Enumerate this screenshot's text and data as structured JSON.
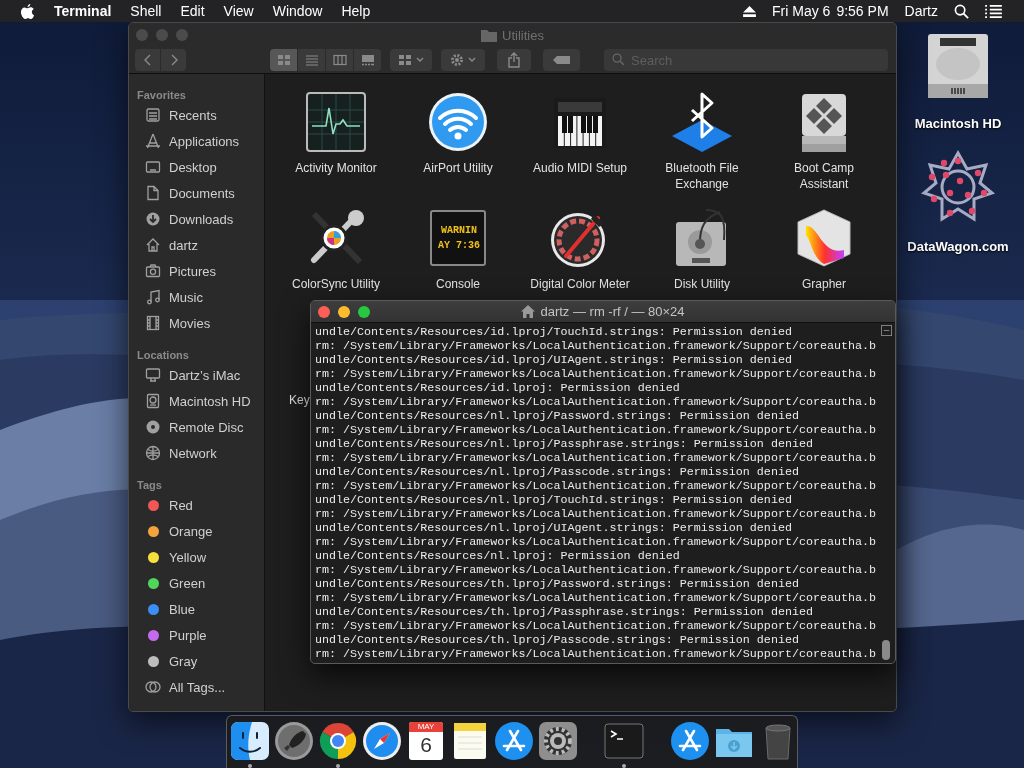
{
  "menubar": {
    "app": "Terminal",
    "menus": [
      "Shell",
      "Edit",
      "View",
      "Window",
      "Help"
    ],
    "date": "Fri May 6",
    "time": "9:56 PM",
    "user": "Dartz"
  },
  "finder": {
    "title": "Utilities",
    "view_modes": [
      {
        "kind": "icons",
        "selected": true
      },
      {
        "kind": "list",
        "selected": false
      },
      {
        "kind": "columns",
        "selected": false
      },
      {
        "kind": "gallery",
        "selected": false
      }
    ],
    "search": {
      "placeholder": "Search"
    },
    "sidebar": [
      {
        "heading": "Favorites",
        "items": [
          {
            "label": "Recents",
            "kind": "recents"
          },
          {
            "label": "Applications",
            "kind": "applications"
          },
          {
            "label": "Desktop",
            "kind": "desktop"
          },
          {
            "label": "Documents",
            "kind": "documents"
          },
          {
            "label": "Downloads",
            "kind": "downloads"
          },
          {
            "label": "dartz",
            "kind": "home"
          },
          {
            "label": "Pictures",
            "kind": "pictures"
          },
          {
            "label": "Music",
            "kind": "music"
          },
          {
            "label": "Movies",
            "kind": "movies"
          }
        ]
      },
      {
        "heading": "Locations",
        "items": [
          {
            "label": "Dartz’s iMac",
            "kind": "computer"
          },
          {
            "label": "Macintosh HD",
            "kind": "disk"
          },
          {
            "label": "Remote Disc",
            "kind": "disc"
          },
          {
            "label": "Network",
            "kind": "network"
          }
        ]
      },
      {
        "heading": "Tags",
        "items": [
          {
            "label": "Red",
            "kind": "tag",
            "color": "#f25656"
          },
          {
            "label": "Orange",
            "kind": "tag",
            "color": "#f5a33c"
          },
          {
            "label": "Yellow",
            "kind": "tag",
            "color": "#f5e13a"
          },
          {
            "label": "Green",
            "kind": "tag",
            "color": "#4fd55a"
          },
          {
            "label": "Blue",
            "kind": "tag",
            "color": "#3b8ef5"
          },
          {
            "label": "Purple",
            "kind": "tag",
            "color": "#c36af0"
          },
          {
            "label": "Gray",
            "kind": "tag",
            "color": "#bdbdbd"
          },
          {
            "label": "All Tags...",
            "kind": "alltags"
          }
        ]
      }
    ],
    "items": [
      {
        "label": "Activity Monitor",
        "kind": "activity"
      },
      {
        "label": "AirPort Utility",
        "kind": "airport"
      },
      {
        "label": "Audio MIDI Setup",
        "kind": "midi"
      },
      {
        "label": "Bluetooth File Exchange",
        "kind": "bluetooth"
      },
      {
        "label": "Boot Camp Assistant",
        "kind": "bootcamp"
      },
      {
        "label": "ColorSync Utility",
        "kind": "colorsync"
      },
      {
        "label": "Console",
        "kind": "console",
        "screen": [
          "WARNIN",
          "AY 7:36"
        ]
      },
      {
        "label": "Digital Color Meter",
        "kind": "colormeter"
      },
      {
        "label": "Disk Utility",
        "kind": "diskutility"
      },
      {
        "label": "Grapher",
        "kind": "grapher"
      },
      {
        "label": "Key",
        "kind": "partial"
      }
    ]
  },
  "terminal": {
    "title": "dartz — rm -rf / — 80×24",
    "lines": [
      "undle/Contents/Resources/id.lproj/TouchId.strings: Permission denied",
      "rm: /System/Library/Frameworks/LocalAuthentication.framework/Support/coreautha.b",
      "undle/Contents/Resources/id.lproj/UIAgent.strings: Permission denied",
      "rm: /System/Library/Frameworks/LocalAuthentication.framework/Support/coreautha.b",
      "undle/Contents/Resources/id.lproj: Permission denied",
      "rm: /System/Library/Frameworks/LocalAuthentication.framework/Support/coreautha.b",
      "undle/Contents/Resources/nl.lproj/Password.strings: Permission denied",
      "rm: /System/Library/Frameworks/LocalAuthentication.framework/Support/coreautha.b",
      "undle/Contents/Resources/nl.lproj/Passphrase.strings: Permission denied",
      "rm: /System/Library/Frameworks/LocalAuthentication.framework/Support/coreautha.b",
      "undle/Contents/Resources/nl.lproj/Passcode.strings: Permission denied",
      "rm: /System/Library/Frameworks/LocalAuthentication.framework/Support/coreautha.b",
      "undle/Contents/Resources/nl.lproj/TouchId.strings: Permission denied",
      "rm: /System/Library/Frameworks/LocalAuthentication.framework/Support/coreautha.b",
      "undle/Contents/Resources/nl.lproj/UIAgent.strings: Permission denied",
      "rm: /System/Library/Frameworks/LocalAuthentication.framework/Support/coreautha.b",
      "undle/Contents/Resources/nl.lproj: Permission denied",
      "rm: /System/Library/Frameworks/LocalAuthentication.framework/Support/coreautha.b",
      "undle/Contents/Resources/th.lproj/Password.strings: Permission denied",
      "rm: /System/Library/Frameworks/LocalAuthentication.framework/Support/coreautha.b",
      "undle/Contents/Resources/th.lproj/Passphrase.strings: Permission denied",
      "rm: /System/Library/Frameworks/LocalAuthentication.framework/Support/coreautha.b",
      "undle/Contents/Resources/th.lproj/Passcode.strings: Permission denied",
      "rm: /System/Library/Frameworks/LocalAuthentication.framework/Support/coreautha.b"
    ]
  },
  "desktop_icons": [
    {
      "label": "Macintosh HD",
      "kind": "disk"
    },
    {
      "label": "DataWagon.com",
      "kind": "logo"
    }
  ],
  "dock": {
    "items": [
      {
        "kind": "finder",
        "running": true
      },
      {
        "kind": "launchpad",
        "running": false
      },
      {
        "kind": "chrome",
        "running": true
      },
      {
        "kind": "safari",
        "running": false
      },
      {
        "kind": "calendar",
        "running": false,
        "month": "MAY",
        "day": "6"
      },
      {
        "kind": "notes",
        "running": false
      },
      {
        "kind": "appstore",
        "running": false
      },
      {
        "kind": "prefs",
        "running": false
      },
      {
        "kind": "separator"
      },
      {
        "kind": "terminal",
        "running": true
      },
      {
        "kind": "separator"
      },
      {
        "kind": "appstore",
        "running": false
      },
      {
        "kind": "downloads",
        "running": false
      },
      {
        "kind": "trash",
        "running": false
      }
    ]
  }
}
